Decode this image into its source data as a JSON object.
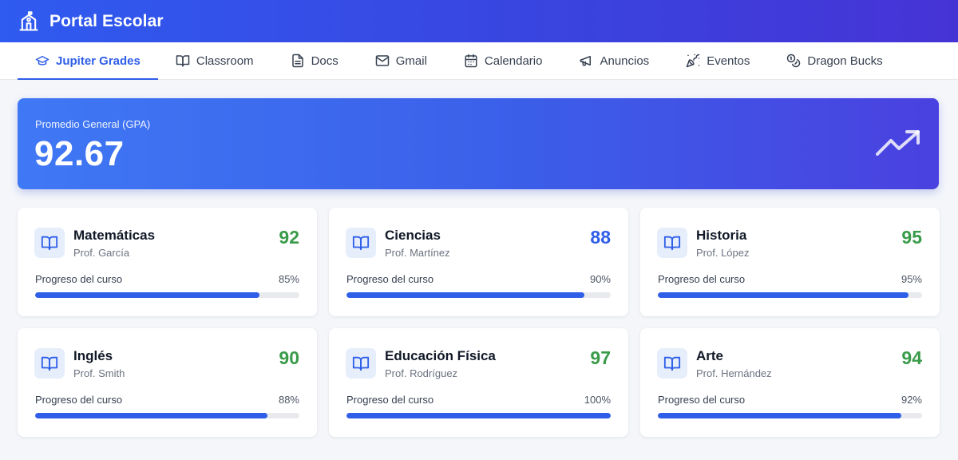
{
  "header": {
    "title": "Portal Escolar",
    "logo_icon": "school-icon"
  },
  "nav": {
    "tabs": [
      {
        "label": "Jupiter Grades",
        "icon": "graduation-cap-icon",
        "active": true
      },
      {
        "label": "Classroom",
        "icon": "book-open-icon",
        "active": false
      },
      {
        "label": "Docs",
        "icon": "document-icon",
        "active": false
      },
      {
        "label": "Gmail",
        "icon": "mail-icon",
        "active": false
      },
      {
        "label": "Calendario",
        "icon": "calendar-icon",
        "active": false
      },
      {
        "label": "Anuncios",
        "icon": "megaphone-icon",
        "active": false
      },
      {
        "label": "Eventos",
        "icon": "party-popper-icon",
        "active": false
      },
      {
        "label": "Dragon Bucks",
        "icon": "coins-icon",
        "active": false
      }
    ]
  },
  "gpa": {
    "label": "Promedio General (GPA)",
    "value": "92.67",
    "icon": "trending-up-icon"
  },
  "colors": {
    "primary": "#2f5ee8",
    "grade_green": "#3a9b4a",
    "grade_blue": "#2f5ee8"
  },
  "courses": [
    {
      "name": "Matemáticas",
      "teacher": "Prof. García",
      "grade": "92",
      "grade_color": "#3a9b4a",
      "progress_label": "Progreso del curso",
      "progress_text": "85%",
      "progress": 85
    },
    {
      "name": "Ciencias",
      "teacher": "Prof. Martínez",
      "grade": "88",
      "grade_color": "#2f5ee8",
      "progress_label": "Progreso del curso",
      "progress_text": "90%",
      "progress": 90
    },
    {
      "name": "Historia",
      "teacher": "Prof. López",
      "grade": "95",
      "grade_color": "#3a9b4a",
      "progress_label": "Progreso del curso",
      "progress_text": "95%",
      "progress": 95
    },
    {
      "name": "Inglés",
      "teacher": "Prof. Smith",
      "grade": "90",
      "grade_color": "#3a9b4a",
      "progress_label": "Progreso del curso",
      "progress_text": "88%",
      "progress": 88
    },
    {
      "name": "Educación Física",
      "teacher": "Prof. Rodríguez",
      "grade": "97",
      "grade_color": "#3a9b4a",
      "progress_label": "Progreso del curso",
      "progress_text": "100%",
      "progress": 100
    },
    {
      "name": "Arte",
      "teacher": "Prof. Hernández",
      "grade": "94",
      "grade_color": "#3a9b4a",
      "progress_label": "Progreso del curso",
      "progress_text": "92%",
      "progress": 92
    }
  ]
}
